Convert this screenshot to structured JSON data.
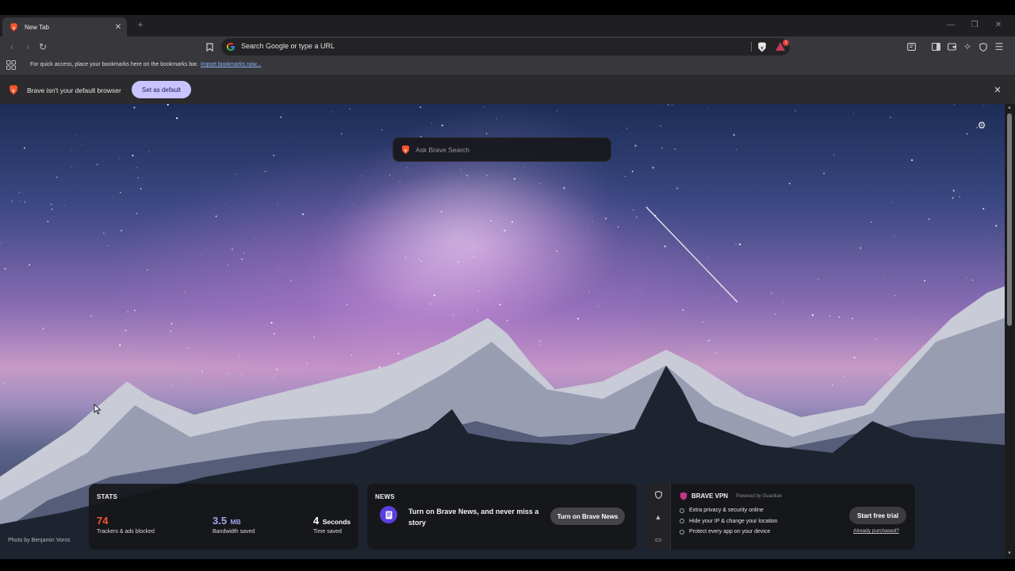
{
  "tabs": [
    {
      "title": "New Tab"
    }
  ],
  "omnibox": {
    "placeholder": "Search Google or type a URL",
    "rewards_badge": "1"
  },
  "bookmarks_bar": {
    "message": "For quick access, place your bookmarks here on the bookmarks bar.",
    "link": "Import bookmarks now..."
  },
  "infobar": {
    "message": "Brave isn't your default browser",
    "button": "Set as default"
  },
  "ntp": {
    "search_placeholder": "Ask Brave Search",
    "photo_credit": "Photo by Benjamin Voros"
  },
  "stats": {
    "title": "STATS",
    "items": [
      {
        "value": "74",
        "unit": "",
        "label": "Trackers & ads blocked",
        "color": "#fb542b"
      },
      {
        "value": "3.5",
        "unit": "MB",
        "label": "Bandwidth saved",
        "color": "#a0a5eb"
      },
      {
        "value": "4",
        "unit": "Seconds",
        "label": "Time saved",
        "color": "#ffffff"
      }
    ]
  },
  "news": {
    "title": "NEWS",
    "message": "Turn on Brave News, and never miss a story",
    "button": "Turn on Brave News"
  },
  "vpn": {
    "name": "BRAVE VPN",
    "powered_by": "Powered by",
    "partner": "Guardian",
    "features": [
      "Extra privacy & security online",
      "Hide your IP & change your location",
      "Protect every app on your device"
    ],
    "button": "Start free trial",
    "link": "Already purchased?"
  },
  "colors": {
    "accent": "#fb542b",
    "brand_purple": "#5a3fe0",
    "set_default_bg": "#c9c4ff"
  }
}
